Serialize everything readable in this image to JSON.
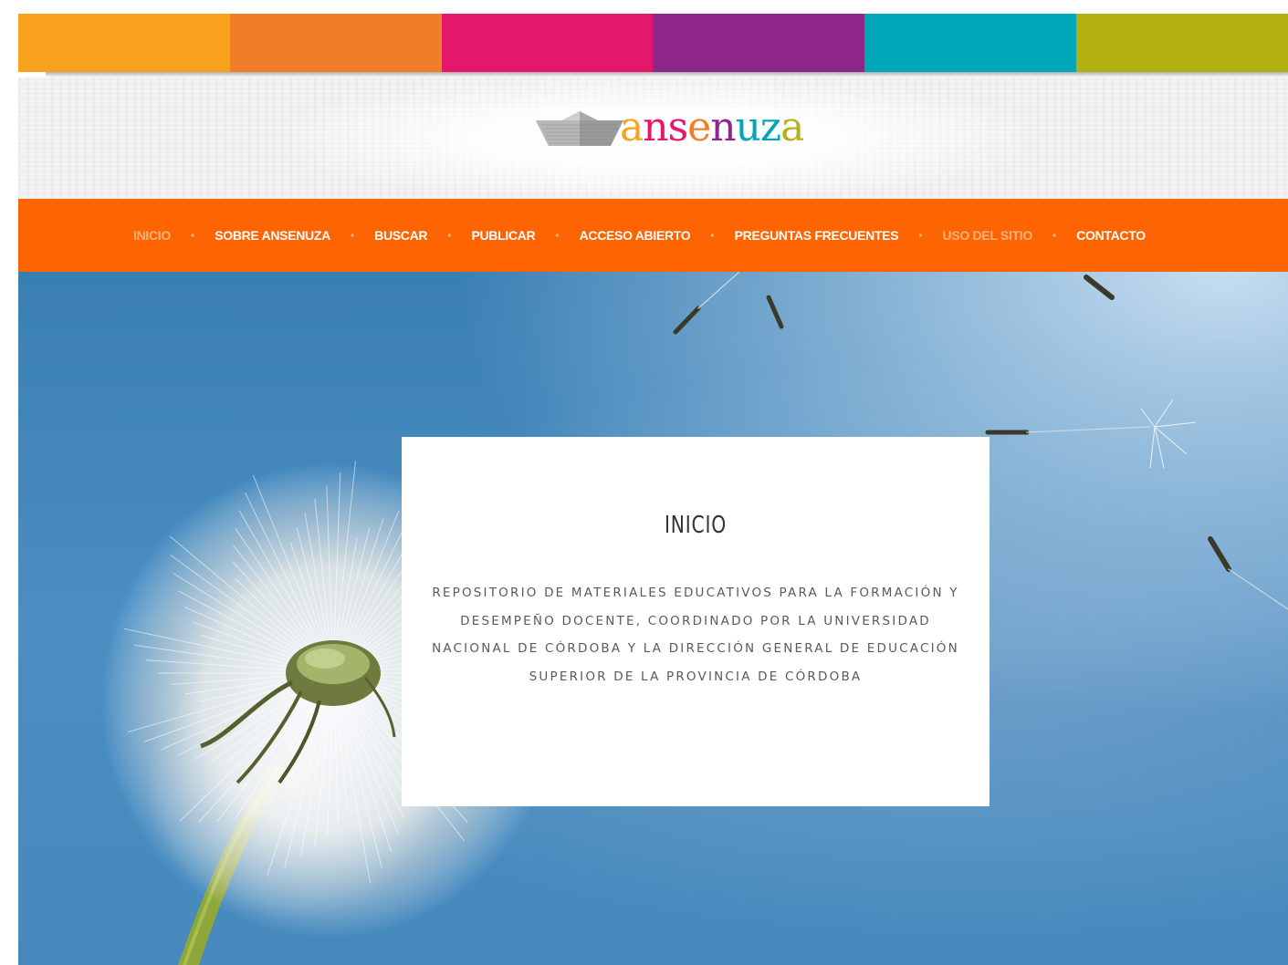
{
  "brand": {
    "name": "ansenuza",
    "letters": [
      {
        "ch": "a",
        "color": "#f7a21b"
      },
      {
        "ch": "n",
        "color": "#e4176d"
      },
      {
        "ch": "s",
        "color": "#e4176d"
      },
      {
        "ch": "e",
        "color": "#f07e26"
      },
      {
        "ch": "n",
        "color": "#8e278a"
      },
      {
        "ch": "u",
        "color": "#00a6b8"
      },
      {
        "ch": "z",
        "color": "#00a6b8"
      },
      {
        "ch": "a",
        "color": "#b5b11a"
      }
    ],
    "logo_icon": "paper-boat-icon"
  },
  "color_band": [
    "#f8a11c",
    "#f07d27",
    "#e3176b",
    "#8f268a",
    "#00a7b9",
    "#b3b014"
  ],
  "nav": {
    "accent": "#fe6502",
    "items": [
      {
        "label": "INICIO",
        "dim": true
      },
      {
        "label": "SOBRE ANSENUZA",
        "dim": false
      },
      {
        "label": "BUSCAR",
        "dim": false
      },
      {
        "label": "PUBLICAR",
        "dim": false
      },
      {
        "label": "ACCESO ABIERTO",
        "dim": false
      },
      {
        "label": "PREGUNTAS FRECUENTES",
        "dim": false
      },
      {
        "label": "USO DEL SITIO",
        "dim": true
      },
      {
        "label": "CONTACTO",
        "dim": false
      }
    ],
    "separator": "•"
  },
  "hero": {
    "image": "dandelion-photo",
    "card": {
      "title": "INICIO",
      "body": "REPOSITORIO DE MATERIALES EDUCATIVOS PARA LA FORMACIÓN Y DESEMPEÑO DOCENTE, COORDINADO POR LA UNIVERSIDAD NACIONAL DE CÓRDOBA Y LA DIRECCIÓN GENERAL DE EDUCACIÓN SUPERIOR DE LA PROVINCIA DE CÓRDOBA"
    }
  }
}
